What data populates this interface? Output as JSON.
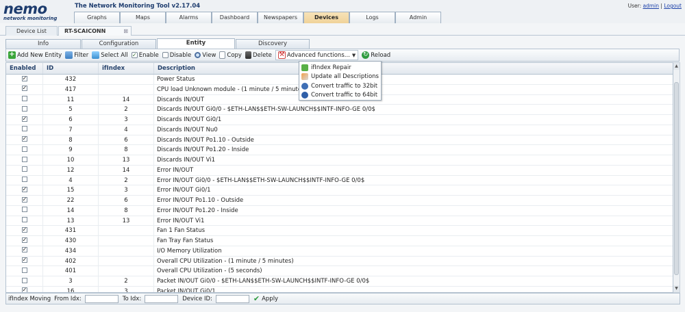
{
  "app": {
    "logo_main": "nemo",
    "logo_sub": "network monitoring",
    "title": "The Network Monitoring Tool v2.17.04",
    "user_label": "User:",
    "user_name": "admin",
    "separator": "|",
    "logout": "Logout"
  },
  "nav": [
    "Graphs",
    "Maps",
    "Alarms",
    "Dashboard",
    "Newspapers",
    "Devices",
    "Logs",
    "Admin"
  ],
  "device_tabs": {
    "list": "Device List",
    "current": "RT-SCAICONN",
    "close": "⊠"
  },
  "sub_tabs": {
    "info": "Info",
    "configuration": "Configuration",
    "entity": "Entity",
    "discovery": "Discovery"
  },
  "toolbar": {
    "add": "Add New Entity",
    "filter": "Filter",
    "select_all": "Select All",
    "enable": "Enable",
    "disable": "Disable",
    "view": "View",
    "copy": "Copy",
    "delete": "Delete",
    "advanced": "Advanced functions...",
    "reload": "Reload"
  },
  "advanced_menu": [
    "ifIndex Repair",
    "Update all Descriptions",
    "Convert traffic to 32bit",
    "Convert traffic to 64bit"
  ],
  "columns": {
    "enabled": "Enabled",
    "id": "ID",
    "ifindex": "ifIndex",
    "description": "Description"
  },
  "rows": [
    {
      "enabled": true,
      "id": "432",
      "ifindex": "",
      "desc": "Power Status"
    },
    {
      "enabled": true,
      "id": "417",
      "ifindex": "",
      "desc": "CPU load Unknown module - (1 minute / 5 minutes)"
    },
    {
      "enabled": false,
      "id": "11",
      "ifindex": "14",
      "desc": "Discards IN/OUT"
    },
    {
      "enabled": false,
      "id": "5",
      "ifindex": "2",
      "desc": "Discards IN/OUT Gi0/0 - $ETH-LAN$$ETH-SW-LAUNCH$$INTF-INFO-GE 0/0$"
    },
    {
      "enabled": true,
      "id": "6",
      "ifindex": "3",
      "desc": "Discards IN/OUT Gi0/1"
    },
    {
      "enabled": false,
      "id": "7",
      "ifindex": "4",
      "desc": "Discards IN/OUT Nu0"
    },
    {
      "enabled": true,
      "id": "8",
      "ifindex": "6",
      "desc": "Discards IN/OUT Po1.10 - Outside"
    },
    {
      "enabled": false,
      "id": "9",
      "ifindex": "8",
      "desc": "Discards IN/OUT Po1.20 - Inside"
    },
    {
      "enabled": false,
      "id": "10",
      "ifindex": "13",
      "desc": "Discards IN/OUT Vi1"
    },
    {
      "enabled": false,
      "id": "12",
      "ifindex": "14",
      "desc": "Error IN/OUT"
    },
    {
      "enabled": false,
      "id": "4",
      "ifindex": "2",
      "desc": "Error IN/OUT Gi0/0 - $ETH-LAN$$ETH-SW-LAUNCH$$INTF-INFO-GE 0/0$"
    },
    {
      "enabled": true,
      "id": "15",
      "ifindex": "3",
      "desc": "Error IN/OUT Gi0/1"
    },
    {
      "enabled": true,
      "id": "22",
      "ifindex": "6",
      "desc": "Error IN/OUT Po1.10 - Outside"
    },
    {
      "enabled": false,
      "id": "14",
      "ifindex": "8",
      "desc": "Error IN/OUT Po1.20 - Inside"
    },
    {
      "enabled": false,
      "id": "13",
      "ifindex": "13",
      "desc": "Error IN/OUT Vi1"
    },
    {
      "enabled": true,
      "id": "431",
      "ifindex": "",
      "desc": "Fan 1 Fan Status"
    },
    {
      "enabled": true,
      "id": "430",
      "ifindex": "",
      "desc": "Fan Tray Fan Status"
    },
    {
      "enabled": true,
      "id": "434",
      "ifindex": "",
      "desc": "I/O Memory Utilization"
    },
    {
      "enabled": true,
      "id": "402",
      "ifindex": "",
      "desc": "Overall CPU Utilization - (1 minute / 5 minutes)"
    },
    {
      "enabled": false,
      "id": "401",
      "ifindex": "",
      "desc": "Overall CPU Utilization - (5 seconds)"
    },
    {
      "enabled": false,
      "id": "3",
      "ifindex": "2",
      "desc": "Packet IN/OUT Gi0/0 - $ETH-LAN$$ETH-SW-LAUNCH$$INTF-INFO-GE 0/0$"
    },
    {
      "enabled": true,
      "id": "16",
      "ifindex": "3",
      "desc": "Packet IN/OUT Gi0/1"
    }
  ],
  "bottom": {
    "title": "ifIndex Moving",
    "from": "From Idx:",
    "to": "To Idx:",
    "device": "Device ID:",
    "apply": "Apply"
  },
  "colors": {
    "brand": "#1d3c6e",
    "active_tab": "#f0d399",
    "header_text": "#26426b"
  }
}
